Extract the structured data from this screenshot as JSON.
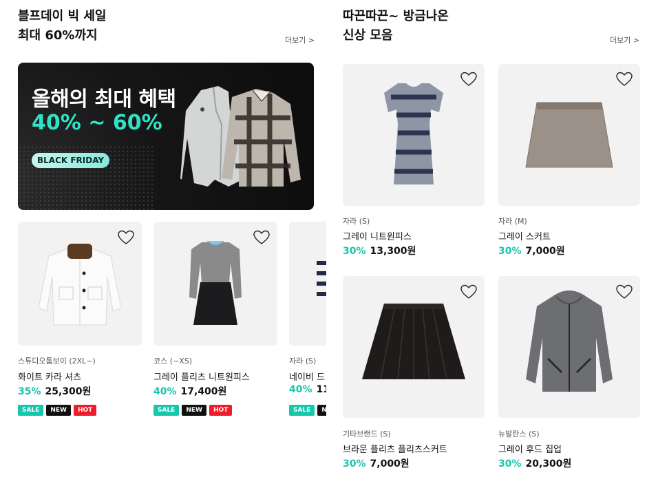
{
  "left": {
    "title_line1": "블프데이 빅 세일",
    "title_line2": "최대 60%까지",
    "more": "더보기 >",
    "banner": {
      "headline": "올해의 최대 혜택",
      "percent": "40% ~ 60%",
      "pill": "BLACK FRIDAY"
    },
    "products": [
      {
        "brand": "스튜디오톰보이 (2XL~)",
        "name": "화이트 카라 셔츠",
        "discount": "35%",
        "price": "25,300원",
        "tags": [
          "SALE",
          "NEW",
          "HOT"
        ]
      },
      {
        "brand": "코스 (~XS)",
        "name": "그레이 플리츠 니트원피스",
        "discount": "40%",
        "price": "17,400원",
        "tags": [
          "SALE",
          "NEW",
          "HOT"
        ]
      },
      {
        "brand": "자라 (S)",
        "name": "네이비 드",
        "discount": "40%",
        "price": "11,",
        "tags": [
          "SALE",
          "N"
        ]
      }
    ]
  },
  "right": {
    "title_line1": "따끈따끈~ 방금나온",
    "title_line2": "신상 모음",
    "more": "더보기 >",
    "products": [
      {
        "brand": "자라 (S)",
        "name": "그레이 니트원피스",
        "discount": "30%",
        "price": "13,300원"
      },
      {
        "brand": "자라 (M)",
        "name": "그레이 스커트",
        "discount": "30%",
        "price": "7,000원"
      },
      {
        "brand": "기타브랜드 (S)",
        "name": "브라운 플리츠 플리츠스커트",
        "discount": "30%",
        "price": "7,000원"
      },
      {
        "brand": "뉴발란스 (S)",
        "name": "그레이 후드 집업",
        "discount": "30%",
        "price": "20,300원"
      }
    ]
  },
  "colors": {
    "accent": "#17c6ab",
    "banner_accent": "#30e3c7",
    "hot": "#ef1d2b",
    "card_bg": "#f2f2f2"
  }
}
